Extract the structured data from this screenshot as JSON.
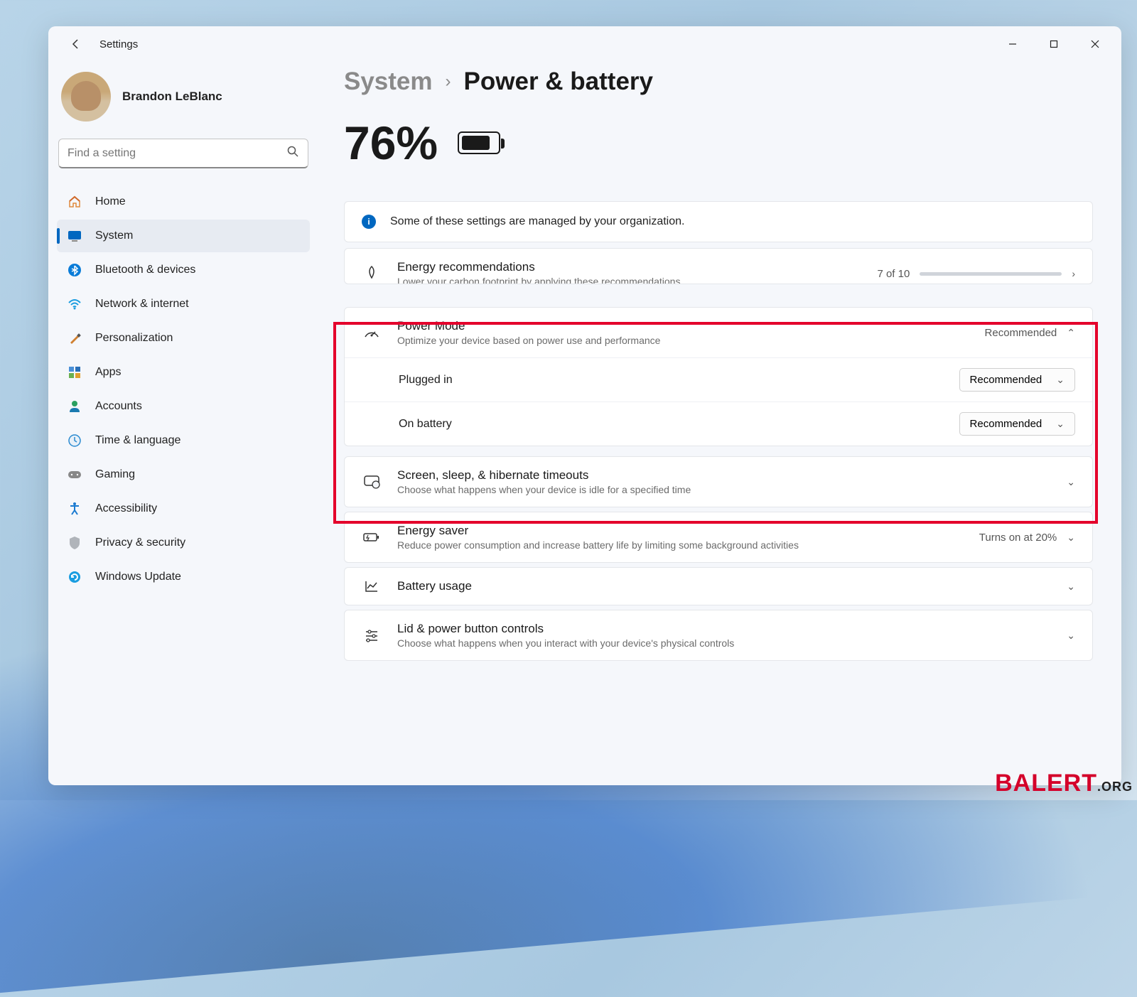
{
  "window": {
    "title": "Settings"
  },
  "profile": {
    "name": "Brandon LeBlanc"
  },
  "search": {
    "placeholder": "Find a setting"
  },
  "nav": {
    "items": [
      {
        "label": "Home"
      },
      {
        "label": "System"
      },
      {
        "label": "Bluetooth & devices"
      },
      {
        "label": "Network & internet"
      },
      {
        "label": "Personalization"
      },
      {
        "label": "Apps"
      },
      {
        "label": "Accounts"
      },
      {
        "label": "Time & language"
      },
      {
        "label": "Gaming"
      },
      {
        "label": "Accessibility"
      },
      {
        "label": "Privacy & security"
      },
      {
        "label": "Windows Update"
      }
    ]
  },
  "breadcrumb": {
    "parent": "System",
    "current": "Power & battery"
  },
  "battery": {
    "percent": "76%"
  },
  "banner": {
    "text": "Some of these settings are managed by your organization."
  },
  "cards": {
    "energy_rec": {
      "title": "Energy recommendations",
      "sub": "Lower your carbon footprint by applying these recommendations",
      "trail": "7 of 10"
    },
    "power_mode": {
      "title": "Power Mode",
      "sub": "Optimize your device based on power use and performance",
      "value": "Recommended",
      "plugged_label": "Plugged in",
      "plugged_value": "Recommended",
      "battery_label": "On battery",
      "battery_value": "Recommended"
    },
    "timeouts": {
      "title": "Screen, sleep, & hibernate timeouts",
      "sub": "Choose what happens when your device is idle for a specified time"
    },
    "energy_saver": {
      "title": "Energy saver",
      "sub": "Reduce power consumption and increase battery life by limiting some background activities",
      "value": "Turns on at 20%"
    },
    "battery_usage": {
      "title": "Battery usage"
    },
    "lid": {
      "title": "Lid & power button controls",
      "sub": "Choose what happens when you interact with your device's physical controls"
    }
  },
  "watermark": {
    "main": "BALERT",
    "sub": ".ORG"
  }
}
